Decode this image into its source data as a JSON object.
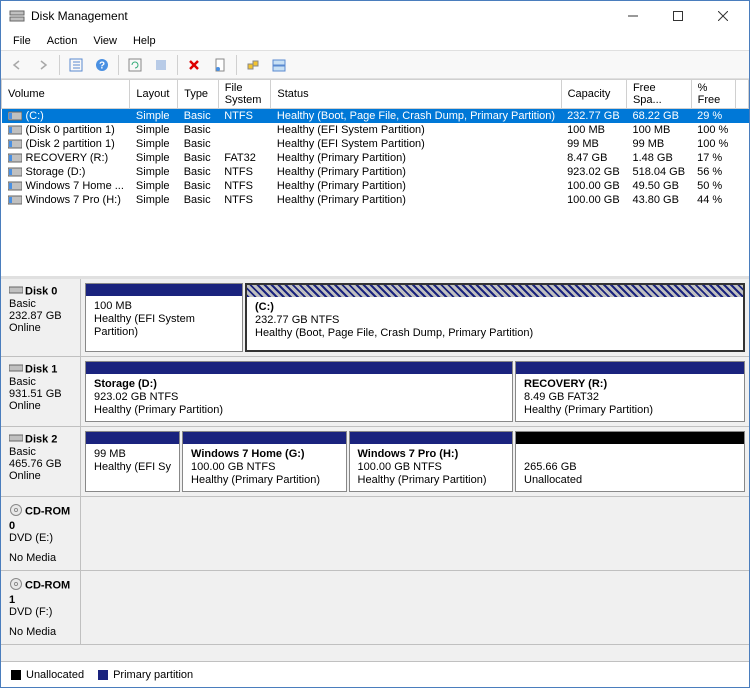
{
  "window": {
    "title": "Disk Management"
  },
  "menu": {
    "file": "File",
    "action": "Action",
    "view": "View",
    "help": "Help"
  },
  "columns": {
    "volume": "Volume",
    "layout": "Layout",
    "type": "Type",
    "fs": "File System",
    "status": "Status",
    "capacity": "Capacity",
    "free": "Free Spa...",
    "pctfree": "% Free"
  },
  "volumes": [
    {
      "name": "(C:)",
      "layout": "Simple",
      "type": "Basic",
      "fs": "NTFS",
      "status": "Healthy (Boot, Page File, Crash Dump, Primary Partition)",
      "capacity": "232.77 GB",
      "free": "68.22 GB",
      "pct": "29 %",
      "selected": true
    },
    {
      "name": "(Disk 0 partition 1)",
      "layout": "Simple",
      "type": "Basic",
      "fs": "",
      "status": "Healthy (EFI System Partition)",
      "capacity": "100 MB",
      "free": "100 MB",
      "pct": "100 %"
    },
    {
      "name": "(Disk 2 partition 1)",
      "layout": "Simple",
      "type": "Basic",
      "fs": "",
      "status": "Healthy (EFI System Partition)",
      "capacity": "99 MB",
      "free": "99 MB",
      "pct": "100 %"
    },
    {
      "name": "RECOVERY (R:)",
      "layout": "Simple",
      "type": "Basic",
      "fs": "FAT32",
      "status": "Healthy (Primary Partition)",
      "capacity": "8.47 GB",
      "free": "1.48 GB",
      "pct": "17 %"
    },
    {
      "name": "Storage (D:)",
      "layout": "Simple",
      "type": "Basic",
      "fs": "NTFS",
      "status": "Healthy (Primary Partition)",
      "capacity": "923.02 GB",
      "free": "518.04 GB",
      "pct": "56 %"
    },
    {
      "name": "Windows 7 Home ...",
      "layout": "Simple",
      "type": "Basic",
      "fs": "NTFS",
      "status": "Healthy (Primary Partition)",
      "capacity": "100.00 GB",
      "free": "49.50 GB",
      "pct": "50 %"
    },
    {
      "name": "Windows 7 Pro (H:)",
      "layout": "Simple",
      "type": "Basic",
      "fs": "NTFS",
      "status": "Healthy (Primary Partition)",
      "capacity": "100.00 GB",
      "free": "43.80 GB",
      "pct": "44 %"
    }
  ],
  "disks": {
    "d0": {
      "name": "Disk 0",
      "type": "Basic",
      "size": "232.87 GB",
      "state": "Online",
      "p0": {
        "l1": "100 MB",
        "l2": "Healthy (EFI System Partition)"
      },
      "p1": {
        "name": "(C:)",
        "l1": "232.77 GB NTFS",
        "l2": "Healthy (Boot, Page File, Crash Dump, Primary Partition)"
      }
    },
    "d1": {
      "name": "Disk 1",
      "type": "Basic",
      "size": "931.51 GB",
      "state": "Online",
      "p0": {
        "name": "Storage  (D:)",
        "l1": "923.02 GB NTFS",
        "l2": "Healthy (Primary Partition)"
      },
      "p1": {
        "name": "RECOVERY  (R:)",
        "l1": "8.49 GB FAT32",
        "l2": "Healthy (Primary Partition)"
      }
    },
    "d2": {
      "name": "Disk 2",
      "type": "Basic",
      "size": "465.76 GB",
      "state": "Online",
      "p0": {
        "l1": "99 MB",
        "l2": "Healthy (EFI Sy"
      },
      "p1": {
        "name": "Windows 7 Home  (G:)",
        "l1": "100.00 GB NTFS",
        "l2": "Healthy (Primary Partition)"
      },
      "p2": {
        "name": "Windows 7 Pro  (H:)",
        "l1": "100.00 GB NTFS",
        "l2": "Healthy (Primary Partition)"
      },
      "p3": {
        "l1": "265.66 GB",
        "l2": "Unallocated"
      }
    },
    "cd0": {
      "name": "CD-ROM 0",
      "drive": "DVD (E:)",
      "state": "No Media"
    },
    "cd1": {
      "name": "CD-ROM 1",
      "drive": "DVD (F:)",
      "state": "No Media"
    }
  },
  "legend": {
    "unalloc": "Unallocated",
    "primary": "Primary partition"
  }
}
